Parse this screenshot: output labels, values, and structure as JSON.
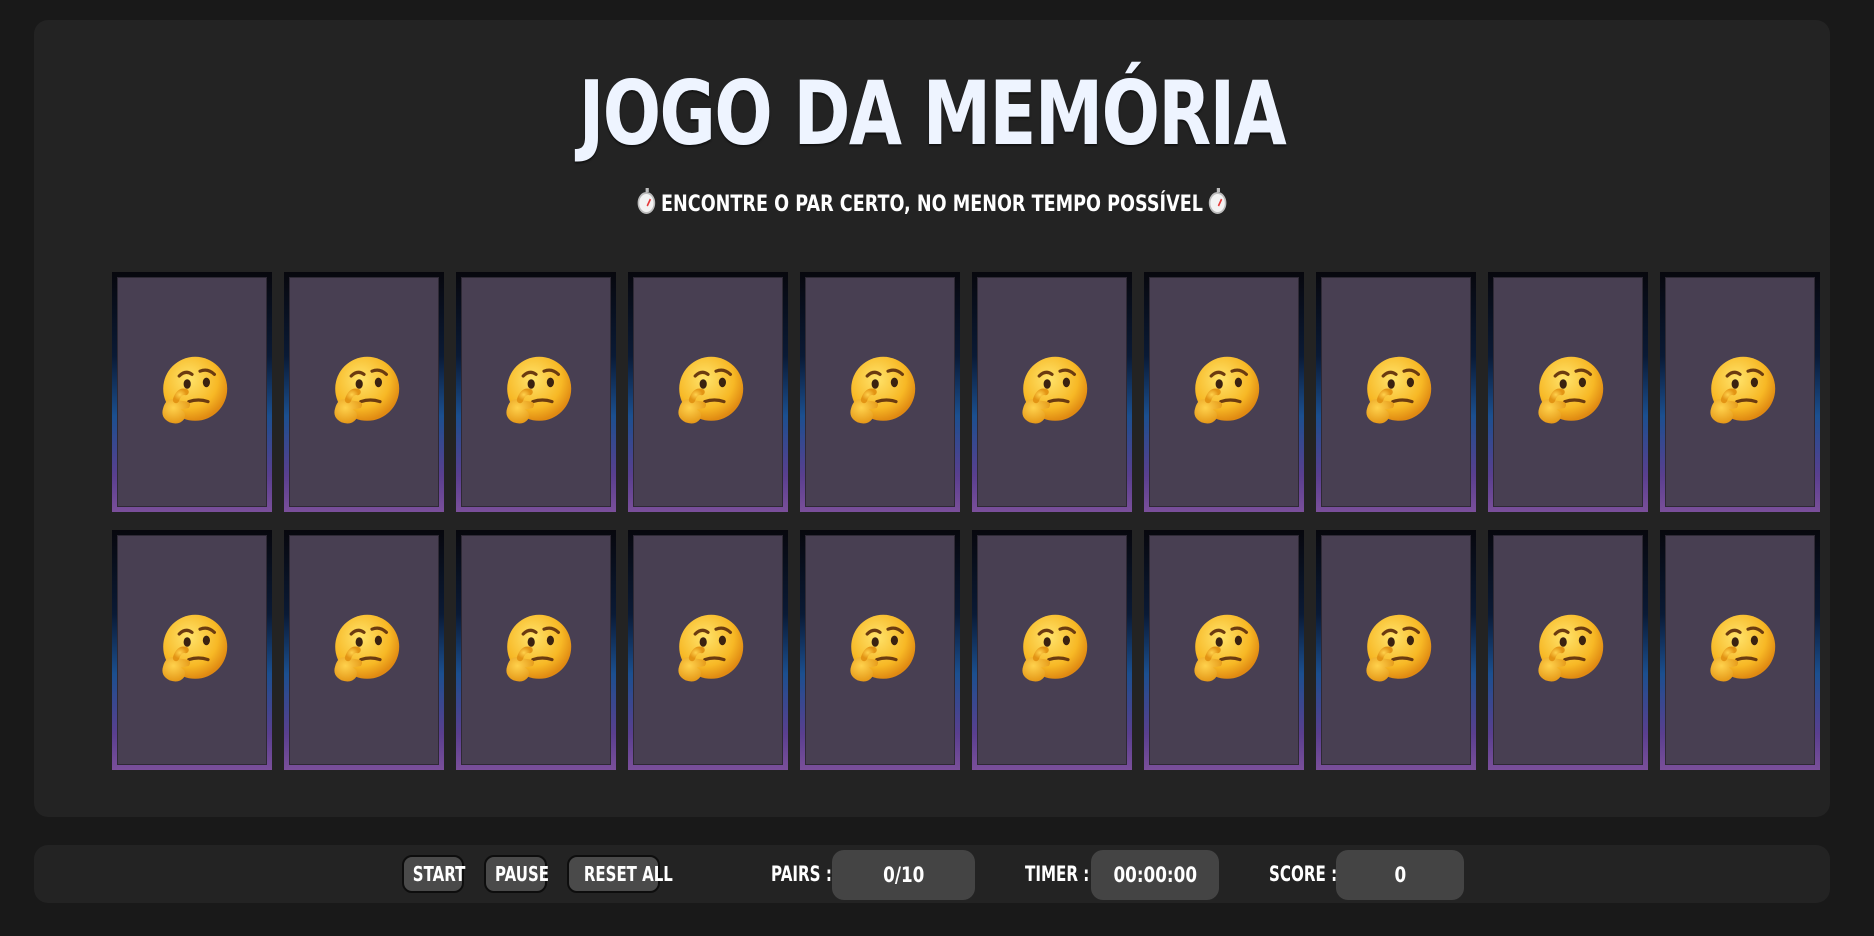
{
  "header": {
    "title": "JOGO DA MEMÓRIA",
    "subtitle": "ENCONTRE O PAR CERTO, NO MENOR TEMPO POSSÍVEL"
  },
  "board": {
    "card_back_icon": "thinking-face-emoji",
    "card_count": 20,
    "rows": 2,
    "columns": 10
  },
  "controls": {
    "start_label": "START",
    "pause_label": "PAUSE",
    "reset_label": "RESET ALL"
  },
  "stats": {
    "pairs_label": "PAIRS :",
    "pairs_value": "0/10",
    "timer_label": "TIMER :",
    "timer_value": "00:00:00",
    "score_label": "SCORE :",
    "score_value": "0"
  },
  "colors": {
    "page_background": "#191919",
    "panel_background": "#232323",
    "card_face": "#483f52",
    "stat_box": "#444444",
    "button": "#4a4a4a",
    "title_text": "#eef4ff"
  }
}
